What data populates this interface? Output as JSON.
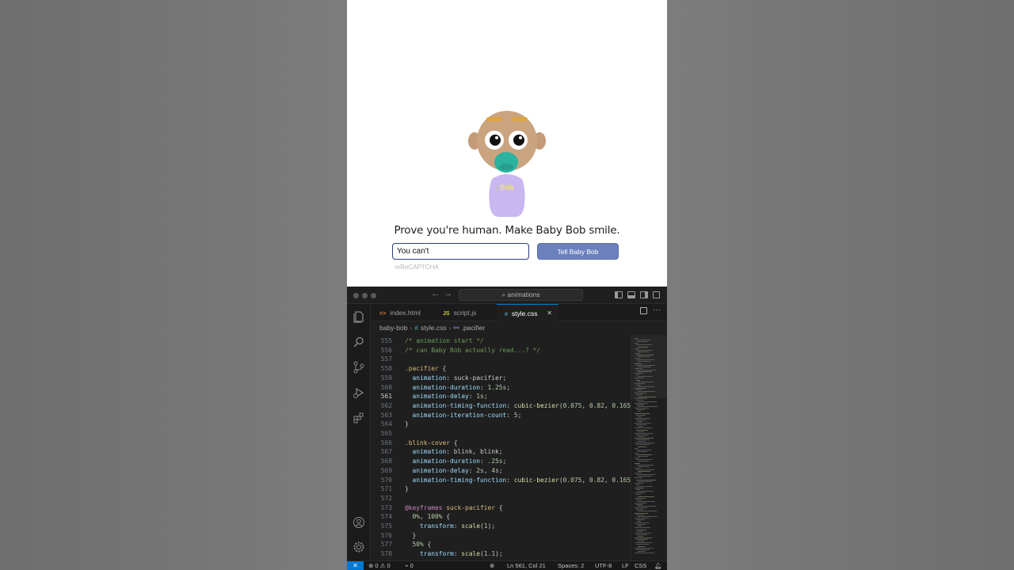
{
  "web": {
    "shirt_label": "Bob",
    "prompt": "Prove you're human. Make Baby Bob smile.",
    "input_value": "You can't",
    "button_label": "Tell Baby Bob",
    "captcha_label": "reReCAPTCHA"
  },
  "vscode": {
    "search_text": "animations",
    "tabs": [
      {
        "icon": "<>",
        "label": "index.html"
      },
      {
        "icon": "JS",
        "label": "script.js"
      },
      {
        "icon": "#",
        "label": "style.css",
        "close": "✕"
      }
    ],
    "breadcrumb": {
      "folder": "baby-bob",
      "file": "style.css",
      "symbol": ".pacifier"
    },
    "lines": [
      {
        "n": "555",
        "t": "/* animation start */"
      },
      {
        "n": "556",
        "t": "/* can Baby Bob actually read...? */"
      },
      {
        "n": "557",
        "t": ""
      },
      {
        "n": "558",
        "t": ".pacifier {"
      },
      {
        "n": "559",
        "t": "  animation: suck-pacifier;"
      },
      {
        "n": "560",
        "t": "  animation-duration: 1.25s;"
      },
      {
        "n": "561",
        "t": "  animation-delay: 1s;"
      },
      {
        "n": "562",
        "t": "  animation-timing-function: cubic-bezier(0.075, 0.82, 0.165,"
      },
      {
        "n": "563",
        "t": "  animation-iteration-count: 5;"
      },
      {
        "n": "564",
        "t": "}"
      },
      {
        "n": "565",
        "t": ""
      },
      {
        "n": "566",
        "t": ".blink-cover {"
      },
      {
        "n": "567",
        "t": "  animation: blink, blink;"
      },
      {
        "n": "568",
        "t": "  animation-duration: .25s;"
      },
      {
        "n": "569",
        "t": "  animation-delay: 2s, 4s;"
      },
      {
        "n": "570",
        "t": "  animation-timing-function: cubic-bezier(0.075, 0.82, 0.165,"
      },
      {
        "n": "571",
        "t": "}"
      },
      {
        "n": "572",
        "t": ""
      },
      {
        "n": "573",
        "t": "@keyframes suck-pacifier {"
      },
      {
        "n": "574",
        "t": "  0%, 100% {"
      },
      {
        "n": "575",
        "t": "    transform: scale(1);"
      },
      {
        "n": "576",
        "t": "  }"
      },
      {
        "n": "577",
        "t": "  50% {"
      },
      {
        "n": "578",
        "t": "    transform: scale(1.1);"
      }
    ],
    "status": {
      "remote": "✕",
      "errors": "0",
      "warnings": "0",
      "ports": "0",
      "position": "Ln 561, Col 21",
      "spaces": "Spaces: 2",
      "encoding": "UTF-8",
      "eol": "LF",
      "language": "CSS"
    },
    "colors": {
      "accent": "#0078d4",
      "button": "#6c80be"
    }
  }
}
